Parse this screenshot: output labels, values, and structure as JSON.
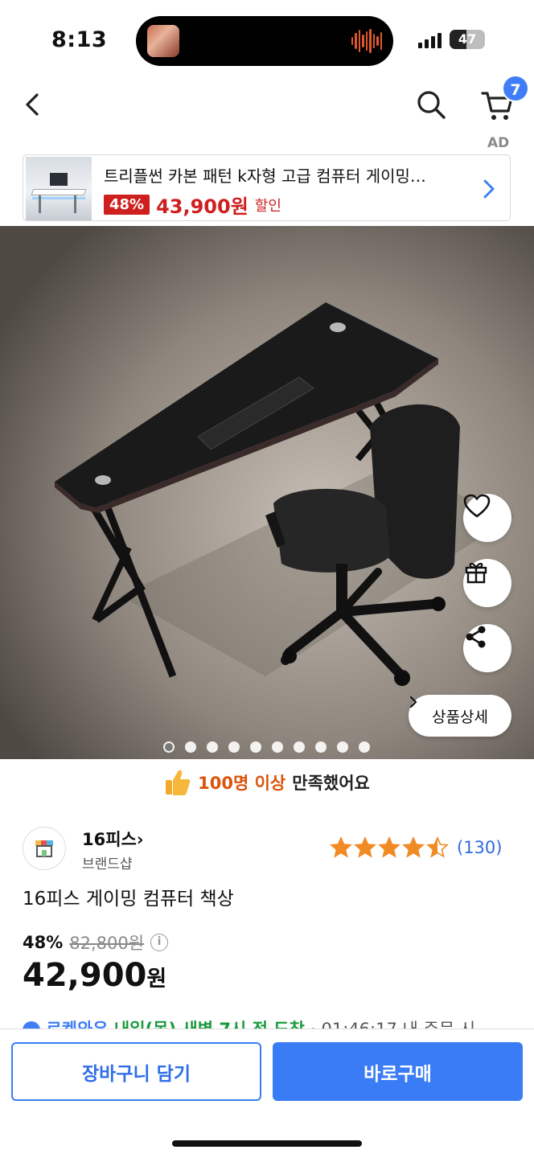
{
  "status_bar": {
    "time": "8:13",
    "battery": "47",
    "battery_level": 0.47
  },
  "nav": {
    "cart_count": "7"
  },
  "ad": {
    "label": "AD",
    "title": "트리플썬 카본 패턴 k자형 고급 컴퓨터 게이밍…",
    "discount": "48%",
    "price": "43,900원",
    "sale_text": "할인"
  },
  "gallery": {
    "detail_button": "상품상세",
    "dots_total": 10,
    "active_index": 0
  },
  "satisfaction": {
    "count": "100명 이상",
    "text": "만족했어요"
  },
  "brand": {
    "name": "16피스",
    "sub": "브랜드샵"
  },
  "rating": {
    "stars": 4.5,
    "count": "(130)"
  },
  "product": {
    "title": "16피스 게이밍 컴퓨터 책상",
    "discount": "48%",
    "original_price": "82,800원",
    "price": "42,900",
    "price_unit": "원"
  },
  "delivery": {
    "prefix": "로켓와우",
    "text": "내일(목) 새벽 7시 전 도착",
    "rest": " · 01:46:17 내 주문 시"
  },
  "bottom": {
    "cart_button": "장바구니 담기",
    "buy_button": "바로구매"
  },
  "colors": {
    "accent": "#3a7cf5",
    "sale": "#cf1f1f",
    "orange": "#d9540b",
    "star": "#f08a24"
  }
}
